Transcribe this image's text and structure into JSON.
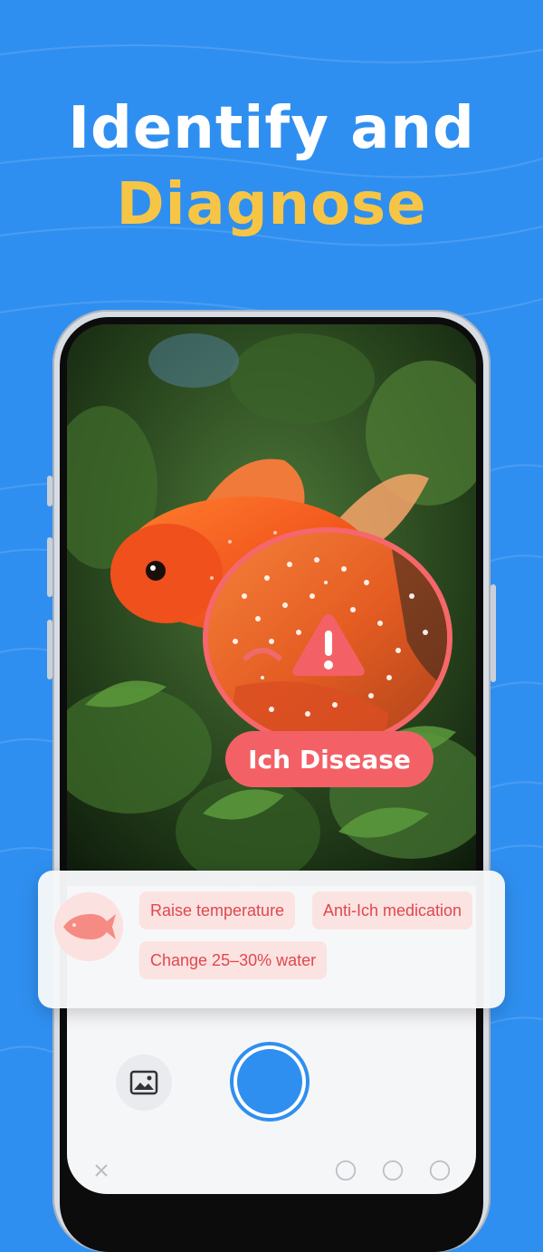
{
  "headline": {
    "line1": "Identify and",
    "line2": "Diagnose"
  },
  "diagnosis": {
    "label": "Ich Disease",
    "icon": "warning-icon"
  },
  "treatments": {
    "items": [
      "Raise temperature",
      "Anti-Ich medication",
      "Change 25–30% water"
    ]
  },
  "camera": {
    "gallery_icon": "image-icon",
    "shutter_icon": "shutter-button",
    "bottom_icons": [
      "close-icon",
      "help-icon",
      "flash-icon",
      "refresh-icon"
    ]
  },
  "colors": {
    "background": "#2f8ff0",
    "accent_yellow": "#f7c545",
    "alert_red": "#f36166"
  }
}
